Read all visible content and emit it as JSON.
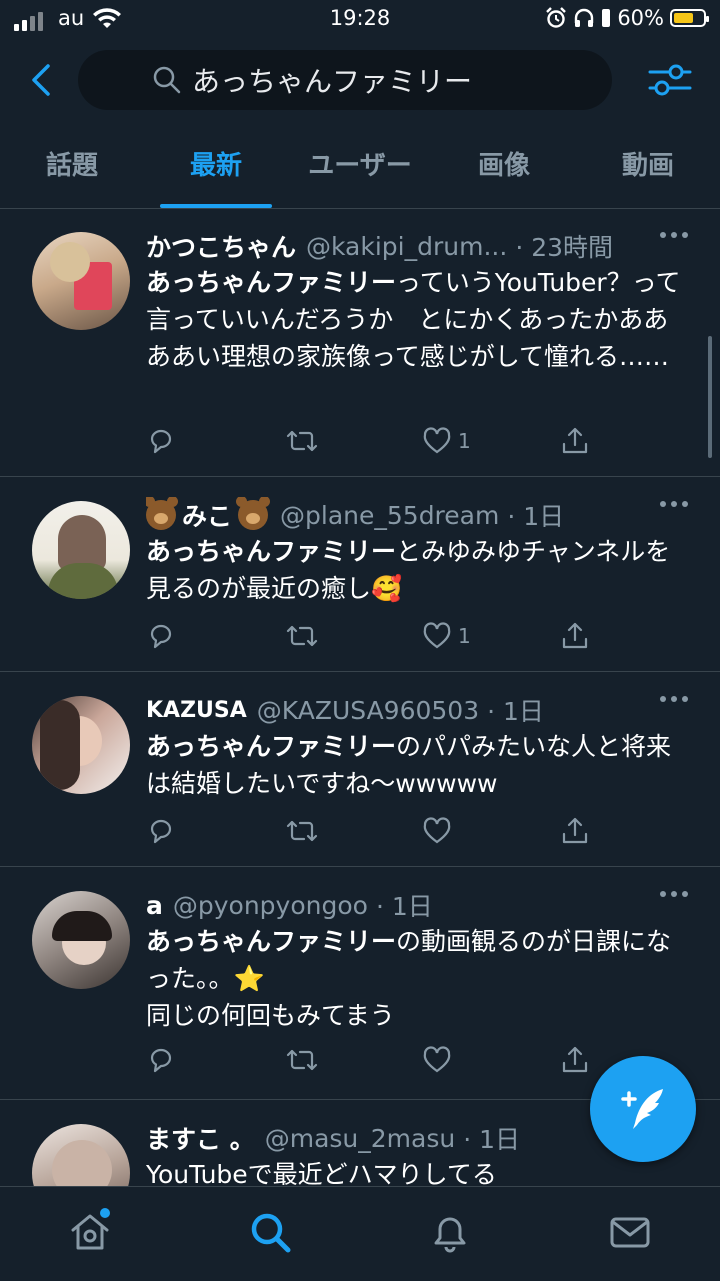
{
  "status_bar": {
    "carrier": "au",
    "time": "19:28",
    "battery": "60%"
  },
  "search": {
    "query": "あっちゃんファミリー"
  },
  "tabs": [
    {
      "label": "話題",
      "active": false
    },
    {
      "label": "最新",
      "active": true
    },
    {
      "label": "ユーザー",
      "active": false
    },
    {
      "label": "画像",
      "active": false
    },
    {
      "label": "動画",
      "active": false
    }
  ],
  "tweets": [
    {
      "name": "かつこちゃん",
      "handle": "@kakipi_drum...",
      "time": "· 23時間",
      "highlight": "あっちゃんファミリー",
      "text": "っていうYouTuber？って言っていいんだろうか　とにかくあったかああああい理想の家族像って感じがして憧れる……",
      "likes": "1"
    },
    {
      "name": "みこ",
      "handle": "@plane_55dream",
      "time": "· 1日",
      "highlight": "あっちゃんファミリー",
      "text": "とみゆみゆチャンネルを見るのが最近の癒し",
      "emoji": "🥰",
      "likes": "1"
    },
    {
      "name": "KAZUSA",
      "handle": "@KAZUSA960503",
      "time": "· 1日",
      "highlight": "あっちゃんファミリー",
      "text": "のパパみたいな人と将来は結婚したいですね〜wwwww",
      "likes": ""
    },
    {
      "name": "a",
      "handle": "@pyonpyongoo",
      "time": "· 1日",
      "highlight": "あっちゃんファミリー",
      "text": "の動画観るのが日課になった。。",
      "emoji": "⭐",
      "text2": "同じの何回もみてまう",
      "likes": ""
    },
    {
      "name": "ますこ 。",
      "handle": "@masu_2masu",
      "time": "· 1日",
      "text": "YouTubeで最近どハマりしてる"
    }
  ],
  "colors": {
    "background": "#15202b",
    "accent": "#1da1f2",
    "secondary_text": "#8899a6",
    "divider": "#38444d"
  },
  "icons": {
    "back": "chevron-left-icon",
    "search": "search-icon",
    "filter": "filter-sliders-icon",
    "reply": "reply-icon",
    "retweet": "retweet-icon",
    "like": "heart-icon",
    "share": "share-icon",
    "compose": "compose-tweet-icon",
    "nav": [
      "home-icon",
      "search-icon",
      "notifications-icon",
      "messages-icon"
    ]
  }
}
